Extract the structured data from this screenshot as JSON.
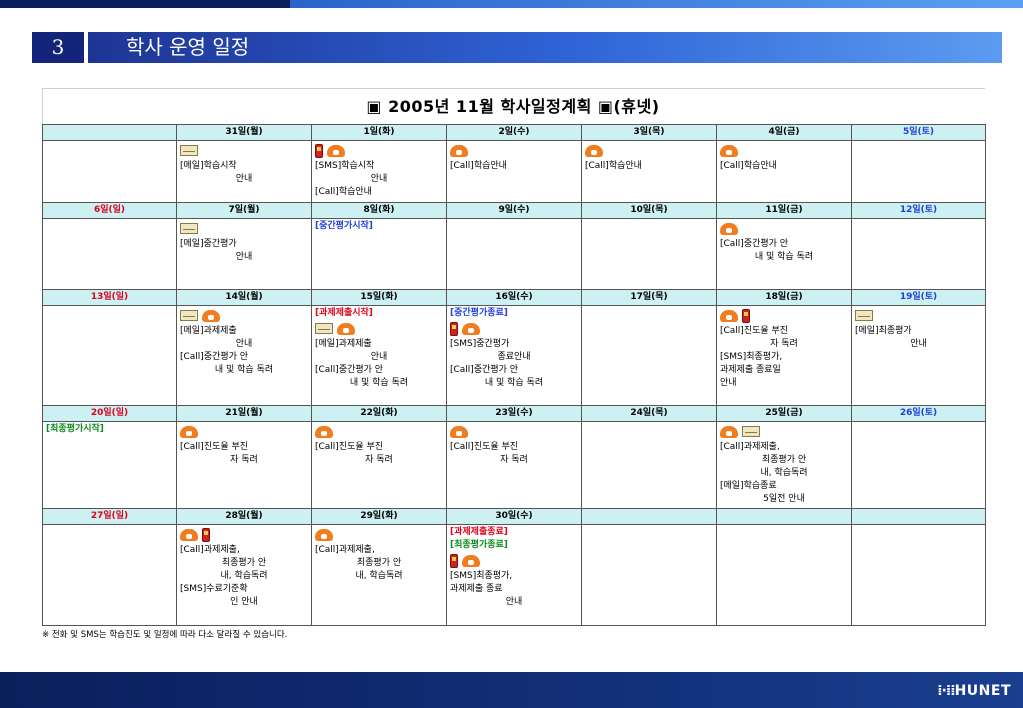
{
  "slide": {
    "section_number": "3",
    "section_title": "학사 운영 일정"
  },
  "calendar": {
    "title": "▣ 2005년 11월 학사일정계획 ▣(휴넷)",
    "weeks": [
      {
        "days": [
          "",
          "31일(월)",
          "1일(화)",
          "2일(수)",
          "3일(목)",
          "4일(금)",
          "5일(토)"
        ],
        "events": [
          {
            "icons": [],
            "tags": [],
            "lines": []
          },
          {
            "icons": [
              "mail-icon"
            ],
            "tags": [],
            "lines": [
              "[메일]학습시작",
              "안내"
            ]
          },
          {
            "icons": [
              "mobile-icon",
              "phone-icon"
            ],
            "tags": [],
            "lines": [
              "[SMS]학습시작",
              "안내",
              "[Call]학습안내"
            ]
          },
          {
            "icons": [
              "phone-icon"
            ],
            "tags": [],
            "lines": [
              "[Call]학습안내"
            ]
          },
          {
            "icons": [
              "phone-icon"
            ],
            "tags": [],
            "lines": [
              "[Call]학습안내"
            ]
          },
          {
            "icons": [
              "phone-icon"
            ],
            "tags": [],
            "lines": [
              "[Call]학습안내"
            ]
          },
          {
            "icons": [],
            "tags": [],
            "lines": []
          }
        ]
      },
      {
        "days": [
          "6일(일)",
          "7일(월)",
          "8일(화)",
          "9일(수)",
          "10일(목)",
          "11일(금)",
          "12일(토)"
        ],
        "events": [
          {
            "icons": [],
            "tags": [],
            "lines": []
          },
          {
            "icons": [
              "mail-icon"
            ],
            "tags": [],
            "lines": [
              "[메일]중간평가",
              "안내"
            ]
          },
          {
            "icons": [],
            "tags": [
              {
                "text": "[중간평가시작]",
                "color": "blue"
              }
            ],
            "lines": []
          },
          {
            "icons": [],
            "tags": [],
            "lines": []
          },
          {
            "icons": [],
            "tags": [],
            "lines": []
          },
          {
            "icons": [
              "phone-icon"
            ],
            "tags": [],
            "lines": [
              "[Call]중간평가 안",
              "내 및 학습 독려"
            ]
          },
          {
            "icons": [],
            "tags": [],
            "lines": []
          }
        ]
      },
      {
        "days": [
          "13일(일)",
          "14일(월)",
          "15일(화)",
          "16일(수)",
          "17일(목)",
          "18일(금)",
          "19일(토)"
        ],
        "events": [
          {
            "icons": [],
            "tags": [],
            "lines": []
          },
          {
            "icons": [
              "mail-icon",
              "phone-icon"
            ],
            "tags": [],
            "lines": [
              "[메일]과제제출",
              "안내",
              "[Call]중간평가 안",
              "내 및 학습 독려"
            ]
          },
          {
            "icons": [
              "mail-icon",
              "phone-icon"
            ],
            "tags": [
              {
                "text": "[과제제출시작]",
                "color": "red"
              }
            ],
            "lines": [
              "[메일]과제제출",
              "안내",
              "[Call]중간평가 안",
              "내 및 학습 독려"
            ]
          },
          {
            "icons": [
              "mobile-icon",
              "phone-icon"
            ],
            "tags": [
              {
                "text": "[중간평가종료]",
                "color": "blue"
              }
            ],
            "lines": [
              "[SMS]중간평가",
              "종료안내",
              "[Call]중간평가 안",
              "내 및 학습 독려"
            ]
          },
          {
            "icons": [],
            "tags": [],
            "lines": []
          },
          {
            "icons": [
              "phone-icon",
              "mobile-icon"
            ],
            "tags": [],
            "lines": [
              "[Call]진도율 부진",
              "자 독려",
              "[SMS]최종평가,",
              "과제제출 종료일",
              "안내"
            ]
          },
          {
            "icons": [
              "mail-icon"
            ],
            "tags": [],
            "lines": [
              "[메일]최종평가",
              "안내"
            ]
          }
        ]
      },
      {
        "days": [
          "20일(일)",
          "21일(월)",
          "22일(화)",
          "23일(수)",
          "24일(목)",
          "25일(금)",
          "26일(토)"
        ],
        "events": [
          {
            "icons": [],
            "tags": [
              {
                "text": "[최종평가시작]",
                "color": "green"
              }
            ],
            "lines": []
          },
          {
            "icons": [
              "phone-icon"
            ],
            "tags": [],
            "lines": [
              "[Call]진도율 부진",
              "자 독려"
            ]
          },
          {
            "icons": [
              "phone-icon"
            ],
            "tags": [],
            "lines": [
              "[Call]진도율 부진",
              "자 독려"
            ]
          },
          {
            "icons": [
              "phone-icon"
            ],
            "tags": [],
            "lines": [
              "[Call]진도율 부진",
              "자 독려"
            ]
          },
          {
            "icons": [],
            "tags": [],
            "lines": []
          },
          {
            "icons": [
              "phone-icon",
              "mail-icon"
            ],
            "tags": [],
            "lines": [
              "[Call]과제제출,",
              "최종평가 안",
              "내, 학습독려",
              "[메일]학습종료",
              "5일전 안내"
            ]
          },
          {
            "icons": [],
            "tags": [],
            "lines": []
          }
        ]
      },
      {
        "days": [
          "27일(일)",
          "28일(월)",
          "29일(화)",
          "30일(수)",
          "",
          "",
          ""
        ],
        "events": [
          {
            "icons": [],
            "tags": [],
            "lines": []
          },
          {
            "icons": [
              "phone-icon",
              "mobile-icon"
            ],
            "tags": [],
            "lines": [
              "[Call]과제제출,",
              "최종평가 안",
              "내, 학습독려",
              "[SMS]수료기준확",
              "인 안내"
            ]
          },
          {
            "icons": [
              "phone-icon"
            ],
            "tags": [],
            "lines": [
              "[Call]과제제출,",
              "최종평가 안",
              "내, 학습독려"
            ]
          },
          {
            "icons": [
              "mobile-icon",
              "phone-icon"
            ],
            "tags": [
              {
                "text": "[과제제출종료]",
                "color": "red"
              },
              {
                "text": "[최종평가종료]",
                "color": "green"
              }
            ],
            "lines": [
              "[SMS]최종평가,",
              "과제제출 종료",
              "안내"
            ]
          },
          {
            "icons": [],
            "tags": [],
            "lines": []
          },
          {
            "icons": [],
            "tags": [],
            "lines": []
          },
          {
            "icons": [],
            "tags": [],
            "lines": []
          }
        ]
      }
    ]
  },
  "footnote": "※ 전화 및 SMS는 학습진도 및 일정에 따라 다소 달라질 수 있습니다.",
  "brand": "HUNET"
}
